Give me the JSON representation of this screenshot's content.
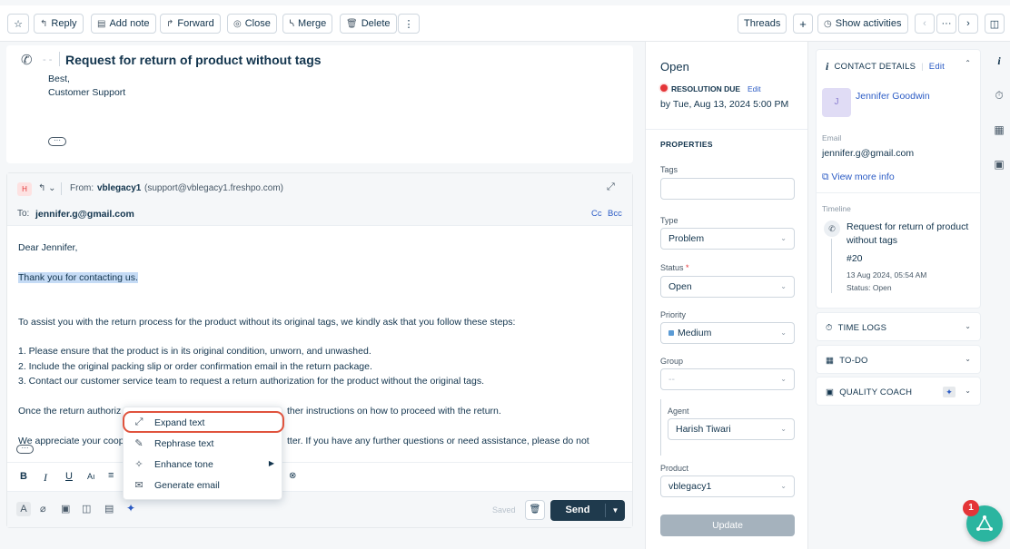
{
  "toolbar": {
    "star": "☆",
    "reply": "Reply",
    "add_note": "Add note",
    "forward": "Forward",
    "close": "Close",
    "merge": "Merge",
    "delete": "Delete",
    "more": "⋮",
    "threads": "Threads",
    "plus": "+",
    "show_activities": "Show activities",
    "nav_prev": "‹",
    "nav_dots": "···",
    "nav_next": "›"
  },
  "ticket": {
    "dashes": "- -",
    "subject": "Request for return of product without tags",
    "prev_line1": "Best,",
    "prev_line2": "Customer Support",
    "ellipsis": "···"
  },
  "reply": {
    "avatar": "H",
    "from_label": "From:",
    "from_name": "vblegacy1",
    "from_email": "(support@vblegacy1.freshpo.com)",
    "to_label": "To:",
    "to_email": "jennifer.g@gmail.com",
    "cc": "Cc",
    "bcc": "Bcc",
    "body": [
      "Dear Jennifer,",
      "Thank you for contacting us.",
      "To assist you with the return process for the product without its original tags, we kindly ask that you follow these steps:",
      "1. Please ensure that the product is in its original condition, unworn, and unwashed.",
      "2. Include the original packing slip or order confirmation email in the return package.",
      "3. Contact our customer service team to request a return authorization for the product without the original tags.",
      "Once the return authoriz",
      "ther instructions on how to proceed with the return.",
      "We appreciate your coop",
      "tter. If you have any further questions or need assistance, please do not"
    ],
    "saved": "Saved",
    "send": "Send"
  },
  "context_menu": {
    "items": [
      "Expand text",
      "Rephrase text",
      "Enhance tone",
      "Generate email"
    ]
  },
  "properties": {
    "status_title": "Open",
    "resolution_label": "RESOLUTION DUE",
    "edit": "Edit",
    "due": "by Tue, Aug 13, 2024 5:00 PM",
    "section": "PROPERTIES",
    "tags_label": "Tags",
    "type_label": "Type",
    "type_value": "Problem",
    "status_label": "Status",
    "required_mark": "*",
    "status_value": "Open",
    "priority_label": "Priority",
    "priority_value": "Medium",
    "group_label": "Group",
    "group_value": "--",
    "agent_label": "Agent",
    "agent_value": "Harish Tiwari",
    "product_label": "Product",
    "product_value": "vblegacy1",
    "update": "Update"
  },
  "contact": {
    "title": "CONTACT DETAILS",
    "edit": "Edit",
    "avatar": "J",
    "name": "Jennifer Goodwin",
    "email_label": "Email",
    "email": "jennifer.g@gmail.com",
    "view_more": "View more info",
    "timeline_label": "Timeline",
    "tl_title": "Request for return of product without tags",
    "tl_id": "#20",
    "tl_date": "13 Aug 2024, 05:54 AM",
    "tl_status": "Status: Open"
  },
  "sections": {
    "time_logs": "TIME LOGS",
    "todo": "TO-DO",
    "quality_coach": "QUALITY COACH"
  },
  "badge": "1",
  "colors": {
    "primary": "#1f3a4d",
    "link": "#2c5cc5",
    "danger": "#e43538",
    "accent_teal": "#2bb5a0"
  }
}
